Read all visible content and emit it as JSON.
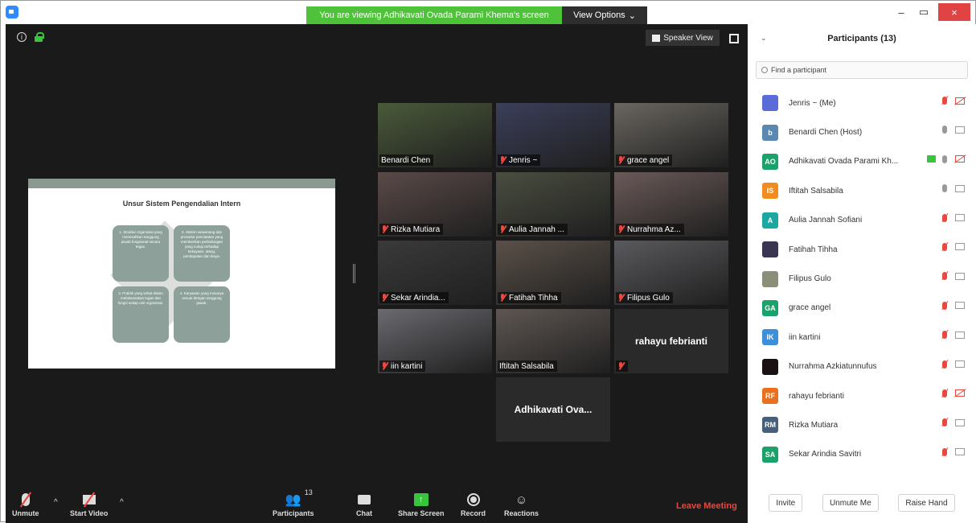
{
  "banner": {
    "text": "You are viewing Adhikavati Ovada Parami Khema's screen",
    "view_options": "View Options"
  },
  "window_controls": [
    "–",
    "▭",
    "×"
  ],
  "meeting": {
    "speaker_view": "Speaker View"
  },
  "slide": {
    "title": "Unsur Sistem Pengendalian Intern",
    "boxes": [
      "1. Struktur organisasi yang memisahkan tanggung jawab fungsional secara tegas.",
      "2. Sistem wewenang dan prosedur pencatatan yang memberikan perlindungan yang cukup terhadap kekayaan, utang, pendapatan dan biaya.",
      "3. Praktik yang sehat dalam melaksanakan tugas dan fungsi setiap unit organisasi.",
      "4. Karyawan yang mutunya sesuai dengan tanggung jawab."
    ]
  },
  "tiles": [
    {
      "name": "Benardi Chen",
      "muted": false,
      "active": true,
      "video": true
    },
    {
      "name": "Jenris ~",
      "muted": true,
      "video": true
    },
    {
      "name": "grace angel",
      "muted": true,
      "video": true
    },
    {
      "name": "Rizka Mutiara",
      "muted": true,
      "video": true
    },
    {
      "name": "Aulia Jannah ...",
      "muted": true,
      "video": true
    },
    {
      "name": "Nurrahma Az...",
      "muted": true,
      "video": true
    },
    {
      "name": "Sekar Arindia...",
      "muted": true,
      "video": true
    },
    {
      "name": "Fatihah Tihha",
      "muted": true,
      "video": true
    },
    {
      "name": "Filipus Gulo",
      "muted": true,
      "video": true
    },
    {
      "name": "iin kartini",
      "muted": true,
      "video": true
    },
    {
      "name": "Iftitah Salsabila",
      "muted": false,
      "video": true
    },
    {
      "name": "rahayu febrianti",
      "muted": true,
      "video": false
    },
    {
      "name": "Adhikavati  Ova...",
      "muted": false,
      "video": false
    }
  ],
  "toolbar": {
    "unmute": "Unmute",
    "start_video": "Start Video",
    "participants": "Participants",
    "participants_count": "13",
    "chat": "Chat",
    "share_screen": "Share Screen",
    "record": "Record",
    "reactions": "Reactions",
    "leave": "Leave Meeting"
  },
  "panel": {
    "title": "Participants (13)",
    "search_placeholder": "Find a participant",
    "participants": [
      {
        "name": "Jenris ~ (Me)",
        "initials": "",
        "color": "#5b6bd8",
        "mic": "muted",
        "cam": "off"
      },
      {
        "name": "Benardi Chen (Host)",
        "initials": "b",
        "color": "#5b88b0",
        "mic": "on",
        "cam": "on"
      },
      {
        "name": "Adhikavati Ovada Parami Kh...",
        "initials": "AO",
        "color": "#1aa26a",
        "mic": "on",
        "cam": "off",
        "sharing": true
      },
      {
        "name": "Iftitah Salsabila",
        "initials": "IS",
        "color": "#f28c1e",
        "mic": "on",
        "cam": "on"
      },
      {
        "name": "Aulia Jannah Sofiani",
        "initials": "A",
        "color": "#1ba8a0",
        "mic": "muted",
        "cam": "on"
      },
      {
        "name": "Fatihah Tihha",
        "initials": "",
        "color": "#3a3550",
        "mic": "muted",
        "cam": "on"
      },
      {
        "name": "Filipus Gulo",
        "initials": "",
        "color": "#8a8f7a",
        "mic": "muted",
        "cam": "on"
      },
      {
        "name": "grace angel",
        "initials": "GA",
        "color": "#1aa26a",
        "mic": "muted",
        "cam": "on"
      },
      {
        "name": "iin kartini",
        "initials": "IK",
        "color": "#3d8fd8",
        "mic": "muted",
        "cam": "on"
      },
      {
        "name": "Nurrahma Azkiatunnufus",
        "initials": "",
        "color": "#1a1212",
        "mic": "muted",
        "cam": "on"
      },
      {
        "name": "rahayu febrianti",
        "initials": "RF",
        "color": "#e8701e",
        "mic": "muted",
        "cam": "off"
      },
      {
        "name": "Rizka Mutiara",
        "initials": "RM",
        "color": "#45607a",
        "mic": "muted",
        "cam": "on"
      },
      {
        "name": "Sekar Arindia Savitri",
        "initials": "SA",
        "color": "#1aa26a",
        "mic": "muted",
        "cam": "on"
      }
    ],
    "invite": "Invite",
    "unmute_me": "Unmute Me",
    "raise_hand": "Raise Hand"
  }
}
